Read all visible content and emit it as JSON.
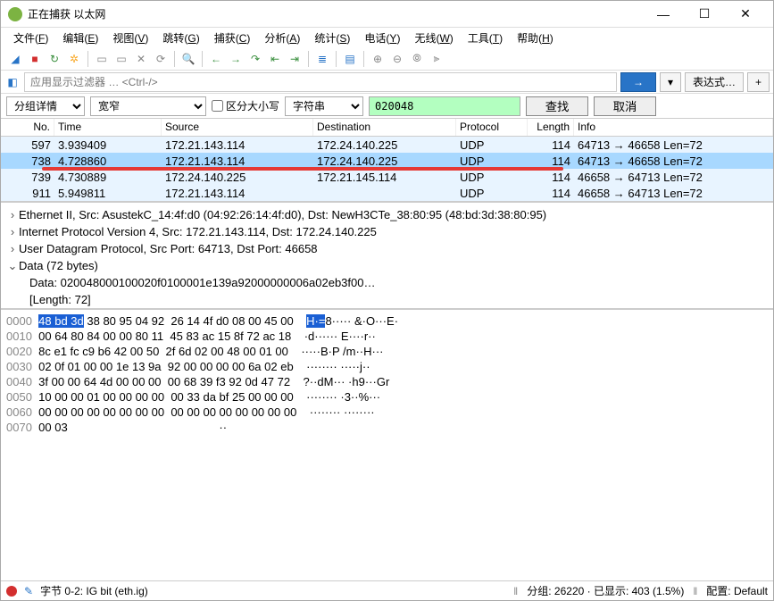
{
  "window": {
    "title": "正在捕获 以太网",
    "minimize": "—",
    "maximize": "☐",
    "close": "✕"
  },
  "menu": [
    {
      "label": "文件",
      "accel": "F"
    },
    {
      "label": "编辑",
      "accel": "E"
    },
    {
      "label": "视图",
      "accel": "V"
    },
    {
      "label": "跳转",
      "accel": "G"
    },
    {
      "label": "捕获",
      "accel": "C"
    },
    {
      "label": "分析",
      "accel": "A"
    },
    {
      "label": "统计",
      "accel": "S"
    },
    {
      "label": "电话",
      "accel": "Y"
    },
    {
      "label": "无线",
      "accel": "W"
    },
    {
      "label": "工具",
      "accel": "T"
    },
    {
      "label": "帮助",
      "accel": "H"
    }
  ],
  "toolbar_icons": [
    {
      "name": "start-capture-icon",
      "glyph": "◢",
      "cls": "tb-blue"
    },
    {
      "name": "stop-capture-icon",
      "glyph": "■",
      "cls": "tb-red"
    },
    {
      "name": "restart-capture-icon",
      "glyph": "↻",
      "cls": "tb-green"
    },
    {
      "name": "capture-options-icon",
      "glyph": "✲",
      "cls": "tb-yellow"
    },
    {
      "sep": true
    },
    {
      "name": "open-file-icon",
      "glyph": "▭",
      "cls": "tb-gray"
    },
    {
      "name": "save-file-icon",
      "glyph": "▭",
      "cls": "tb-gray"
    },
    {
      "name": "close-file-icon",
      "glyph": "✕",
      "cls": "tb-gray"
    },
    {
      "name": "reload-icon",
      "glyph": "⟳",
      "cls": "tb-gray"
    },
    {
      "sep": true
    },
    {
      "name": "find-icon",
      "glyph": "🔍",
      "cls": "tb-gray"
    },
    {
      "sep": true
    },
    {
      "name": "go-back-icon",
      "glyph": "←",
      "cls": "tb-green"
    },
    {
      "name": "go-forward-icon",
      "glyph": "→",
      "cls": "tb-green"
    },
    {
      "name": "go-to-packet-icon",
      "glyph": "↷",
      "cls": "tb-green"
    },
    {
      "name": "go-first-icon",
      "glyph": "⇤",
      "cls": "tb-green"
    },
    {
      "name": "go-last-icon",
      "glyph": "⇥",
      "cls": "tb-green"
    },
    {
      "sep": true
    },
    {
      "name": "auto-scroll-icon",
      "glyph": "≣",
      "cls": "tb-blue"
    },
    {
      "sep": true
    },
    {
      "name": "colorize-icon",
      "glyph": "▤",
      "cls": "tb-blue"
    },
    {
      "sep": true
    },
    {
      "name": "zoom-in-icon",
      "glyph": "⊕",
      "cls": "tb-gray"
    },
    {
      "name": "zoom-out-icon",
      "glyph": "⊖",
      "cls": "tb-gray"
    },
    {
      "name": "zoom-reset-icon",
      "glyph": "⦾",
      "cls": "tb-gray"
    },
    {
      "name": "resize-columns-icon",
      "glyph": "⫸",
      "cls": "tb-gray"
    }
  ],
  "filter": {
    "placeholder": "应用显示过滤器 … <Ctrl-/>",
    "go": "→",
    "expr": "表达式…",
    "plus": "+"
  },
  "search": {
    "scope": "分组详情",
    "width": "宽窄",
    "case_label": "区分大小写",
    "type": "字符串",
    "value": "020048",
    "find_btn": "查找",
    "cancel_btn": "取消"
  },
  "columns": {
    "no": "No.",
    "time": "Time",
    "src": "Source",
    "dst": "Destination",
    "proto": "Protocol",
    "len": "Length",
    "info": "Info"
  },
  "packets": [
    {
      "no": "597",
      "time": "3.939409",
      "src": "172.21.143.114",
      "dst": "172.24.140.225",
      "proto": "UDP",
      "len": "114",
      "info": "64713 → 46658  Len=72",
      "sel": false
    },
    {
      "no": "738",
      "time": "4.728860",
      "src": "172.21.143.114",
      "dst": "172.24.140.225",
      "proto": "UDP",
      "len": "114",
      "info": "64713 → 46658  Len=72",
      "sel": true
    },
    {
      "no": "739",
      "time": "4.730889",
      "src": "172.24.140.225",
      "dst": "172.21.145.114",
      "proto": "UDP",
      "len": "114",
      "info": "46658 → 64713  Len=72",
      "sel": false
    },
    {
      "no": "911",
      "time": "5.949811",
      "src": "172.21.143.114",
      "dst": "",
      "proto": "UDP",
      "len": "114",
      "info": "46658 → 64713  Len=72",
      "sel": false
    }
  ],
  "details": [
    {
      "caret": "›",
      "text": "Ethernet II, Src: AsustekC_14:4f:d0 (04:92:26:14:4f:d0), Dst: NewH3CTe_38:80:95 (48:bd:3d:38:80:95)"
    },
    {
      "caret": "›",
      "text": "Internet Protocol Version 4, Src: 172.21.143.114, Dst: 172.24.140.225"
    },
    {
      "caret": "›",
      "text": "User Datagram Protocol, Src Port: 64713, Dst Port: 46658"
    },
    {
      "caret": "⌄",
      "text": "Data (72 bytes)"
    },
    {
      "caret": "",
      "indent": true,
      "text": "Data: 020048000100020f0100001e139a92000000006a02eb3f00…"
    },
    {
      "caret": "",
      "indent": true,
      "text": "[Length: 72]"
    }
  ],
  "hex": [
    {
      "off": "0000",
      "p1": "48 bd 3d",
      "p2": " 38 80 95 04 92  26 14 4f d0 08 00 45 00",
      "a1": "H·=",
      "a2": "8····· &·O···E·",
      "hl": true
    },
    {
      "off": "0010",
      "p1": "",
      "p2": "00 64 80 84 00 00 80 11  45 83 ac 15 8f 72 ac 18",
      "a1": "",
      "a2": "·d······ E····r··"
    },
    {
      "off": "0020",
      "p1": "",
      "p2": "8c e1 fc c9 b6 42 00 50  2f 6d 02 00 48 00 01 00",
      "a1": "",
      "a2": "·····B·P /m··H···"
    },
    {
      "off": "0030",
      "p1": "",
      "p2": "02 0f 01 00 00 1e 13 9a  92 00 00 00 00 6a 02 eb",
      "a1": "",
      "a2": "········ ·····j··"
    },
    {
      "off": "0040",
      "p1": "",
      "p2": "3f 00 00 64 4d 00 00 00  00 68 39 f3 92 0d 47 72",
      "a1": "",
      "a2": "?··dM··· ·h9···Gr"
    },
    {
      "off": "0050",
      "p1": "",
      "p2": "10 00 00 01 00 00 00 00  00 33 da bf 25 00 00 00",
      "a1": "",
      "a2": "········ ·3··%···"
    },
    {
      "off": "0060",
      "p1": "",
      "p2": "00 00 00 00 00 00 00 00  00 00 00 00 00 00 00 00",
      "a1": "",
      "a2": "········ ········"
    },
    {
      "off": "0070",
      "p1": "",
      "p2": "00 03",
      "a1": "",
      "a2": "··"
    }
  ],
  "status": {
    "field": "字节 0-2: IG bit (eth.ig)",
    "packets": "分组: 26220 · 已显示: 403 (1.5%)",
    "profile": "配置: Default"
  }
}
